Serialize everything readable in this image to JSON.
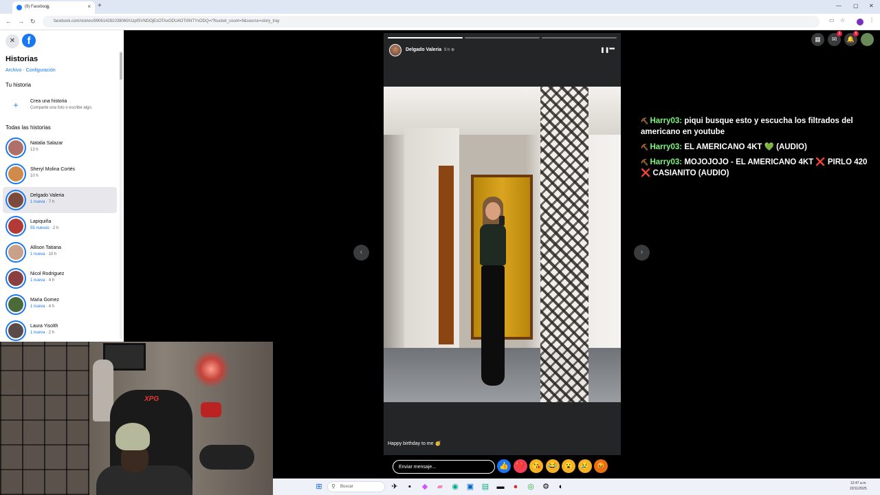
{
  "browser": {
    "tab_title": "(9) Facebook",
    "url": "facebook.com/stories/990614281038060/UzpfSVNDOjEzOTAxODU4OTI0NTYxODQ=/?bucket_count=9&source=story_tray",
    "new_tab": "+",
    "tab_close": "×"
  },
  "sidebar": {
    "title": "Historias",
    "link_archive": "Archivo",
    "link_sep": " · ",
    "link_settings": "Configuración",
    "your_story_heading": "Tu historia",
    "create_title": "Crea una historia",
    "create_subtitle": "Comparte una foto o escribe algo.",
    "create_plus": "+",
    "all_stories_heading": "Todas las historias",
    "stories": [
      {
        "name": "Natalia Salazar",
        "meta": "13 h",
        "new": "",
        "color": "#b0706a",
        "active": false
      },
      {
        "name": "Sheryl Molina Cortés",
        "meta": "10 h",
        "new": "",
        "color": "#d08a4a",
        "active": false
      },
      {
        "name": "Delgado Valeria",
        "meta": " · 7 h",
        "new": "1 nueva",
        "color": "#7a4a3a",
        "active": true
      },
      {
        "name": "Lapiquiña",
        "meta": " · 2 h",
        "new": "55 nuevas",
        "color": "#b43a3a",
        "active": false
      },
      {
        "name": "Allison Tatiana",
        "meta": " · 10 h",
        "new": "1 nueva",
        "color": "#c9a08a",
        "active": false
      },
      {
        "name": "Nicol Rodriguez",
        "meta": " · 4 h",
        "new": "1 nueva",
        "color": "#8a4040",
        "active": false
      },
      {
        "name": "Maria Gomez",
        "meta": " · 4 h",
        "new": "1 nueva",
        "color": "#4a6a3a",
        "active": false
      },
      {
        "name": "Laura Yisolth",
        "meta": " · 2 h",
        "new": "1 nueva",
        "color": "#5a4a4a",
        "active": false
      }
    ]
  },
  "story": {
    "author": "Delgado Valeria",
    "time": "9 h",
    "caption": "Happy birthday to me 🥳",
    "progress": [
      1.0,
      0.0,
      0.0
    ],
    "reply_placeholder": "Enviar mensaje...",
    "reactions": [
      "👍",
      "❤️",
      "😘",
      "😂",
      "😮",
      "😢",
      "😡"
    ]
  },
  "chat": [
    {
      "user": "Harry03:",
      "message": "piqui busque esto y escucha los filtrados del americano en youtube"
    },
    {
      "user": "Harry03:",
      "message": "EL AMERICANO 4KT 💚 (AUDIO)"
    },
    {
      "user": "Harry03:",
      "message": "MOJOJOJO - EL AMERICANO 4KT ❌ PIRLO 420 ❌ CASIANITO (AUDIO)"
    }
  ],
  "fb_icons": {
    "menu_badge": "",
    "messenger_badge": "2",
    "notifications_badge": "5"
  },
  "taskbar": {
    "search_placeholder": "Buscar",
    "clock_time": "12:47 a.m.",
    "clock_date": "22/11/2025"
  }
}
